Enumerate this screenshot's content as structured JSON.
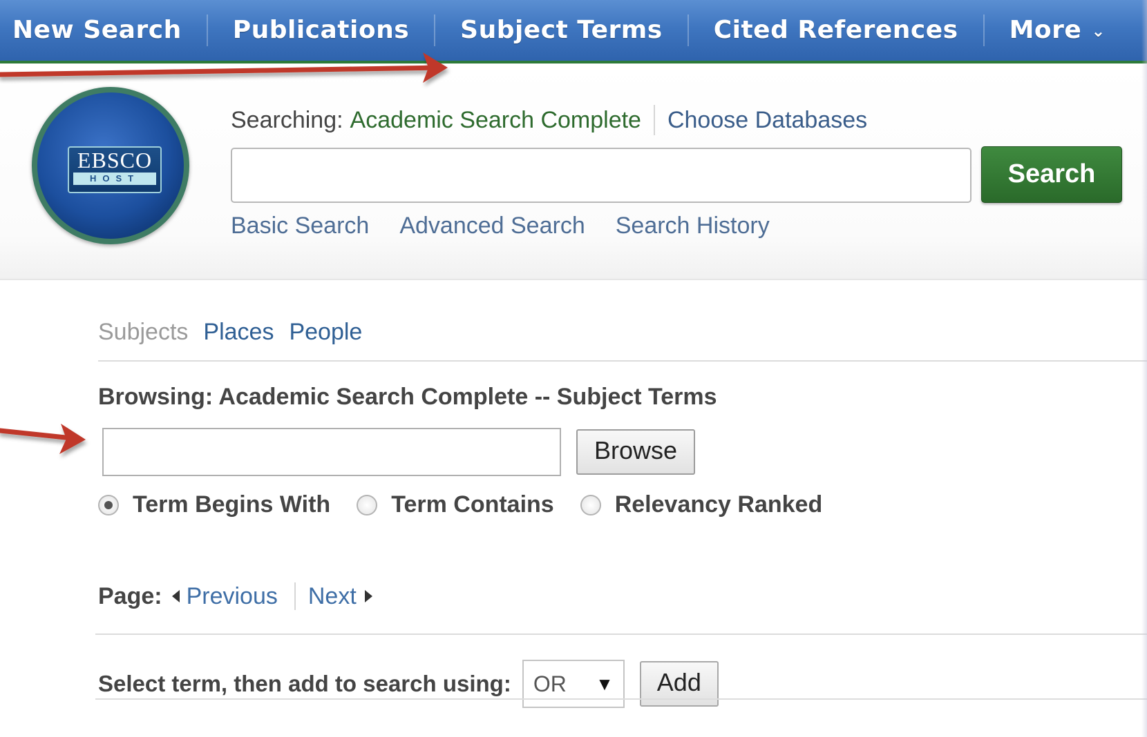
{
  "nav": {
    "items": [
      "New Search",
      "Publications",
      "Subject Terms",
      "Cited References",
      "More"
    ]
  },
  "logo": {
    "line1": "EBSCO",
    "line2": "HOST"
  },
  "header": {
    "searching_label": "Searching:",
    "database_name": "Academic Search Complete",
    "choose_databases": "Choose Databases",
    "search_value": "",
    "search_button": "Search",
    "links": [
      "Basic Search",
      "Advanced Search",
      "Search History"
    ]
  },
  "tabs": {
    "subjects": "Subjects",
    "places": "Places",
    "people": "People"
  },
  "browsing": {
    "title": "Browsing: Academic Search Complete -- Subject Terms",
    "input_value": "",
    "browse_button": "Browse",
    "options": [
      {
        "label": "Term Begins With",
        "checked": true
      },
      {
        "label": "Term Contains",
        "checked": false
      },
      {
        "label": "Relevancy Ranked",
        "checked": false
      }
    ]
  },
  "pager": {
    "label": "Page:",
    "previous": "Previous",
    "next": "Next"
  },
  "add_row": {
    "label": "Select term, then add to search using:",
    "operator": "OR",
    "add_button": "Add"
  },
  "colors": {
    "nav_blue": "#3f76c0",
    "search_green": "#2e6b2e",
    "arrow_red": "#c0392b",
    "link_blue": "#3e6ea6"
  }
}
